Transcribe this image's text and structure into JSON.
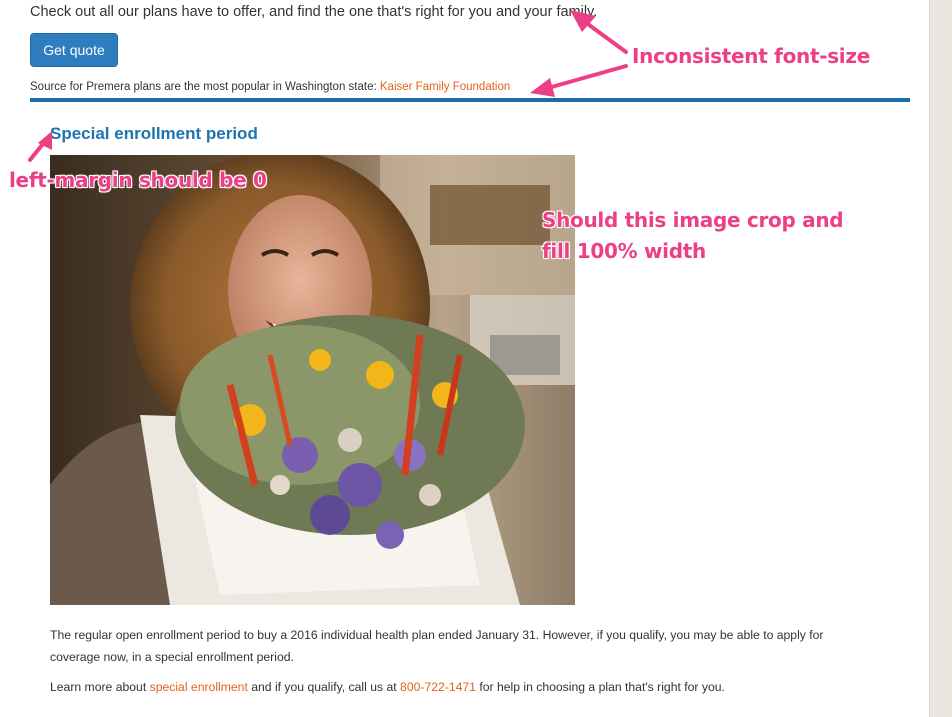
{
  "intro": {
    "text": "Check out all our plans have to offer, and find the one that's right for you and your family."
  },
  "quote_button": {
    "label": "Get quote"
  },
  "source": {
    "text": "Source for Premera plans are the most popular in Washington state: ",
    "link": "Kaiser Family Foundation"
  },
  "section": {
    "title": "Special enrollment period"
  },
  "paragraphs": {
    "p1": "The regular open enrollment period to buy a 2016 individual health plan ended January 31. However, if you qualify, you may be able to apply for coverage now, in a special enrollment period.",
    "p2_before": "Learn more about ",
    "p2_link": "special enrollment",
    "p2_middle": " and if you qualify, call us at ",
    "p2_phone": "800-722-1471",
    "p2_after": " for help in choosing a plan that's right for you."
  },
  "annotations": {
    "font_size": "Inconsistent font-size",
    "left_margin": "left-margin should be 0",
    "image_line1": "Should this image crop and",
    "image_line2": "fill 100% width"
  },
  "colors": {
    "accent_blue": "#1f73b0",
    "button_blue": "#2e7ebf",
    "link_orange": "#e0631c",
    "annotation_pink": "#ec3f86"
  }
}
